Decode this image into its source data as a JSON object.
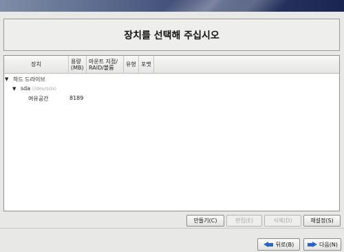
{
  "page": {
    "title": "장치를 선택해 주십시오"
  },
  "table": {
    "headers": {
      "device": "장치",
      "size_line1": "용량",
      "size_line2": "(MB)",
      "mount_line1": "마운트 지점/",
      "mount_line2": "RAID/볼륨",
      "type": "유형",
      "format": "포맷"
    },
    "rows": [
      {
        "label": "하드 드라이브",
        "sub": "",
        "size": ""
      },
      {
        "label": "sda",
        "sub": "(/dev/sda)",
        "size": ""
      },
      {
        "label": "여유공간",
        "sub": "",
        "size": "8189"
      }
    ]
  },
  "actions": {
    "create": "만들기(C)",
    "edit": "편집(E)",
    "delete": "삭제(D)",
    "reset": "재설정(S)"
  },
  "nav": {
    "back": "뒤로(B)",
    "next": "다음(N)"
  }
}
